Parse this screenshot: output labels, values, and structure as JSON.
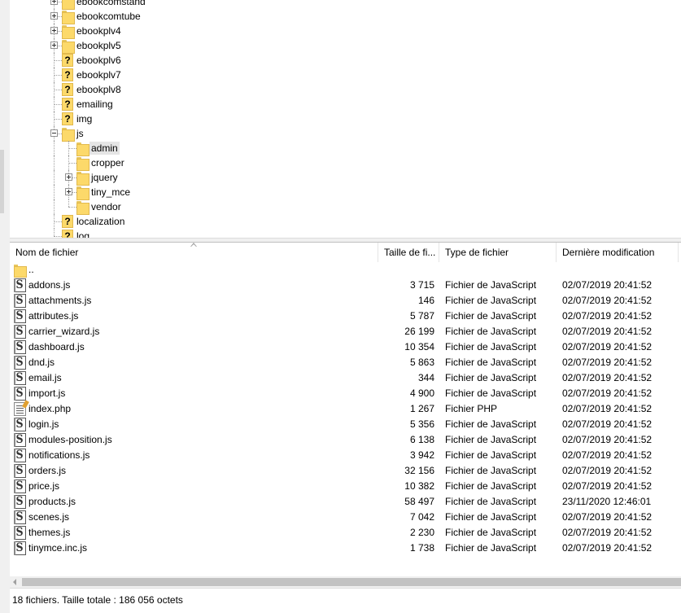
{
  "tree": {
    "items": [
      {
        "label": "ebookcomstand",
        "icon": "folder-icon",
        "expander": "plus",
        "depth": 0
      },
      {
        "label": "ebookcomtube",
        "icon": "folder-icon",
        "expander": "plus",
        "depth": 0
      },
      {
        "label": "ebookplv4",
        "icon": "folder-icon",
        "expander": "plus",
        "depth": 0
      },
      {
        "label": "ebookplv5",
        "icon": "folder-icon",
        "expander": "plus",
        "depth": 0
      },
      {
        "label": "ebookplv6",
        "icon": "unknown-folder-icon",
        "expander": "",
        "depth": 0
      },
      {
        "label": "ebookplv7",
        "icon": "unknown-folder-icon",
        "expander": "",
        "depth": 0
      },
      {
        "label": "ebookplv8",
        "icon": "unknown-folder-icon",
        "expander": "",
        "depth": 0
      },
      {
        "label": "emailing",
        "icon": "unknown-folder-icon",
        "expander": "",
        "depth": 0
      },
      {
        "label": "img",
        "icon": "unknown-folder-icon",
        "expander": "",
        "depth": 0
      },
      {
        "label": "js",
        "icon": "folder-icon",
        "expander": "minus",
        "depth": 0
      },
      {
        "label": "admin",
        "icon": "folder-icon",
        "expander": "",
        "depth": 1,
        "selected": true
      },
      {
        "label": "cropper",
        "icon": "folder-icon",
        "expander": "",
        "depth": 1
      },
      {
        "label": "jquery",
        "icon": "folder-icon",
        "expander": "plus",
        "depth": 1
      },
      {
        "label": "tiny_mce",
        "icon": "folder-icon",
        "expander": "plus",
        "depth": 1
      },
      {
        "label": "vendor",
        "icon": "folder-icon",
        "expander": "",
        "depth": 1
      },
      {
        "label": "localization",
        "icon": "unknown-folder-icon",
        "expander": "",
        "depth": 0
      },
      {
        "label": "log",
        "icon": "unknown-folder-icon",
        "expander": "",
        "depth": 0
      }
    ]
  },
  "list": {
    "columns": {
      "name": "Nom de fichier",
      "size": "Taille de fi...",
      "type": "Type de fichier",
      "modified": "Dernière modification"
    },
    "rows": [
      {
        "name": "..",
        "size": "",
        "type": "",
        "modified": "",
        "icon": "parent-folder-icon",
        "kind": "up"
      },
      {
        "name": "addons.js",
        "size": "3 715",
        "type": "Fichier de JavaScript",
        "modified": "02/07/2019 20:41:52",
        "icon": "javascript-file-icon",
        "kind": "js"
      },
      {
        "name": "attachments.js",
        "size": "146",
        "type": "Fichier de JavaScript",
        "modified": "02/07/2019 20:41:52",
        "icon": "javascript-file-icon",
        "kind": "js"
      },
      {
        "name": "attributes.js",
        "size": "5 787",
        "type": "Fichier de JavaScript",
        "modified": "02/07/2019 20:41:52",
        "icon": "javascript-file-icon",
        "kind": "js"
      },
      {
        "name": "carrier_wizard.js",
        "size": "26 199",
        "type": "Fichier de JavaScript",
        "modified": "02/07/2019 20:41:52",
        "icon": "javascript-file-icon",
        "kind": "js"
      },
      {
        "name": "dashboard.js",
        "size": "10 354",
        "type": "Fichier de JavaScript",
        "modified": "02/07/2019 20:41:52",
        "icon": "javascript-file-icon",
        "kind": "js"
      },
      {
        "name": "dnd.js",
        "size": "5 863",
        "type": "Fichier de JavaScript",
        "modified": "02/07/2019 20:41:52",
        "icon": "javascript-file-icon",
        "kind": "js"
      },
      {
        "name": "email.js",
        "size": "344",
        "type": "Fichier de JavaScript",
        "modified": "02/07/2019 20:41:52",
        "icon": "javascript-file-icon",
        "kind": "js"
      },
      {
        "name": "import.js",
        "size": "4 900",
        "type": "Fichier de JavaScript",
        "modified": "02/07/2019 20:41:52",
        "icon": "javascript-file-icon",
        "kind": "js"
      },
      {
        "name": "index.php",
        "size": "1 267",
        "type": "Fichier PHP",
        "modified": "02/07/2019 20:41:52",
        "icon": "php-file-icon",
        "kind": "php"
      },
      {
        "name": "login.js",
        "size": "5 356",
        "type": "Fichier de JavaScript",
        "modified": "02/07/2019 20:41:52",
        "icon": "javascript-file-icon",
        "kind": "js"
      },
      {
        "name": "modules-position.js",
        "size": "6 138",
        "type": "Fichier de JavaScript",
        "modified": "02/07/2019 20:41:52",
        "icon": "javascript-file-icon",
        "kind": "js"
      },
      {
        "name": "notifications.js",
        "size": "3 942",
        "type": "Fichier de JavaScript",
        "modified": "02/07/2019 20:41:52",
        "icon": "javascript-file-icon",
        "kind": "js"
      },
      {
        "name": "orders.js",
        "size": "32 156",
        "type": "Fichier de JavaScript",
        "modified": "02/07/2019 20:41:52",
        "icon": "javascript-file-icon",
        "kind": "js"
      },
      {
        "name": "price.js",
        "size": "10 382",
        "type": "Fichier de JavaScript",
        "modified": "02/07/2019 20:41:52",
        "icon": "javascript-file-icon",
        "kind": "js"
      },
      {
        "name": "products.js",
        "size": "58 497",
        "type": "Fichier de JavaScript",
        "modified": "23/11/2020 12:46:01",
        "icon": "javascript-file-icon",
        "kind": "js"
      },
      {
        "name": "scenes.js",
        "size": "7 042",
        "type": "Fichier de JavaScript",
        "modified": "02/07/2019 20:41:52",
        "icon": "javascript-file-icon",
        "kind": "js"
      },
      {
        "name": "themes.js",
        "size": "2 230",
        "type": "Fichier de JavaScript",
        "modified": "02/07/2019 20:41:52",
        "icon": "javascript-file-icon",
        "kind": "js"
      },
      {
        "name": "tinymce.inc.js",
        "size": "1 738",
        "type": "Fichier de JavaScript",
        "modified": "02/07/2019 20:41:52",
        "icon": "javascript-file-icon",
        "kind": "js"
      }
    ]
  },
  "status": {
    "text": "18 fichiers. Taille totale : 186 056 octets"
  },
  "colors": {
    "folder": "#fcd96a",
    "selection": "#e5e5e5",
    "chrome": "#f0f0f0",
    "scroll_thumb": "#c2c2c2"
  }
}
